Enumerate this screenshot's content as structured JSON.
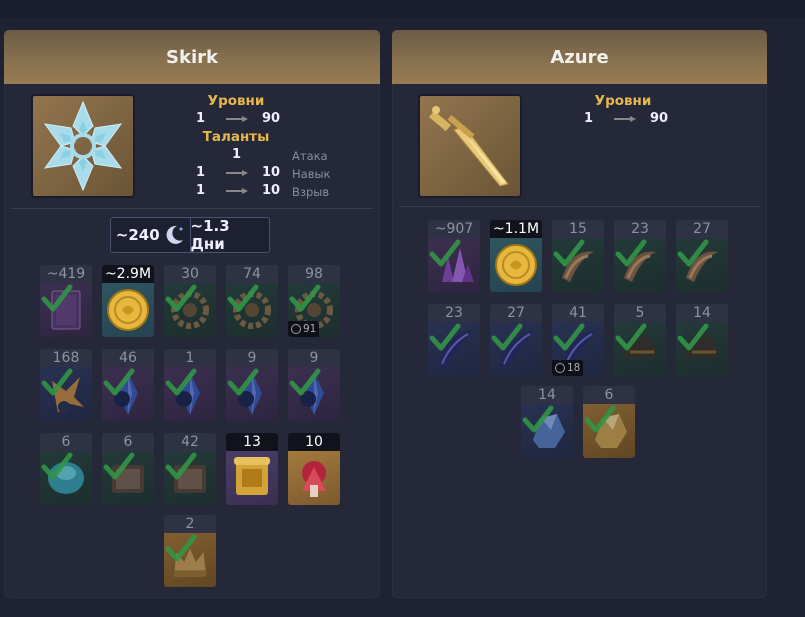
{
  "cards": [
    {
      "name": "Skirk",
      "levels_title": "Уровни",
      "level_from": "1",
      "level_to": "90",
      "talents_title": "Таланты",
      "talents": [
        {
          "from": "1",
          "to": "",
          "name": "Атака"
        },
        {
          "from": "1",
          "to": "10",
          "name": "Навык"
        },
        {
          "from": "1",
          "to": "10",
          "name": "Взрыв"
        }
      ],
      "summary": {
        "resin": "~240",
        "days": "~1.3 Дни",
        "icon": "moon-icon"
      }
    },
    {
      "name": "Azure",
      "levels_title": "Уровни",
      "level_from": "1",
      "level_to": "90"
    }
  ],
  "skirk_items": [
    {
      "count": "~419",
      "icon": "book-icon",
      "badge": ""
    },
    {
      "count": "~2.9M",
      "icon": "mora-coin-icon",
      "badge": ""
    },
    {
      "count": "30",
      "icon": "gear-icon",
      "badge": ""
    },
    {
      "count": "74",
      "icon": "gear-icon",
      "badge": ""
    },
    {
      "count": "98",
      "icon": "gear-icon",
      "badge": "91"
    },
    {
      "count": "168",
      "icon": "flower-icon",
      "badge": ""
    },
    {
      "count": "46",
      "icon": "crystal-shard-icon",
      "badge": ""
    },
    {
      "count": "1",
      "icon": "crystal-shard-icon",
      "badge": ""
    },
    {
      "count": "9",
      "icon": "crystal-shard-icon",
      "badge": ""
    },
    {
      "count": "9",
      "icon": "crystal-shard-icon",
      "badge": ""
    },
    {
      "count": "6",
      "icon": "gem-icon",
      "badge": ""
    },
    {
      "count": "6",
      "icon": "scroll-icon",
      "badge": ""
    },
    {
      "count": "42",
      "icon": "scroll-icon",
      "badge": ""
    },
    {
      "count": "13",
      "icon": "golden-scroll-icon",
      "badge": ""
    },
    {
      "count": "10",
      "icon": "red-relic-icon",
      "badge": ""
    },
    {
      "count": "2",
      "icon": "crown-icon",
      "badge": ""
    }
  ],
  "azure_items": [
    {
      "count": "~907",
      "icon": "purple-crystal-icon",
      "badge": ""
    },
    {
      "count": "~1.1M",
      "icon": "mora-coin-icon",
      "badge": ""
    },
    {
      "count": "15",
      "icon": "tusk-icon",
      "badge": ""
    },
    {
      "count": "23",
      "icon": "tusk-icon",
      "badge": ""
    },
    {
      "count": "27",
      "icon": "tusk-icon",
      "badge": ""
    },
    {
      "count": "23",
      "icon": "dark-feather-icon",
      "badge": ""
    },
    {
      "count": "27",
      "icon": "dark-feather-icon",
      "badge": ""
    },
    {
      "count": "41",
      "icon": "dark-feather-icon",
      "badge": "18"
    },
    {
      "count": "5",
      "icon": "helmet-icon",
      "badge": ""
    },
    {
      "count": "14",
      "icon": "helmet-icon",
      "badge": ""
    },
    {
      "count": "14",
      "icon": "blue-ore-icon",
      "badge": ""
    },
    {
      "count": "6",
      "icon": "gold-ore-icon",
      "badge": ""
    }
  ]
}
